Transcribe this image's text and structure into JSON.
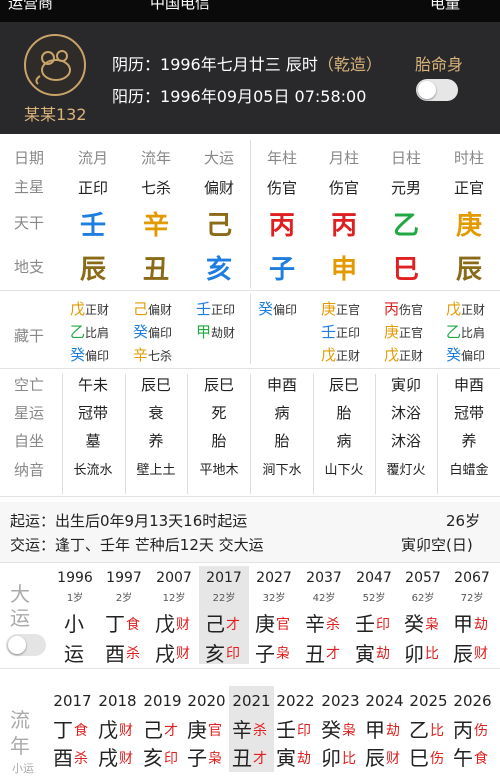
{
  "status": {
    "left1": "运营商",
    "left2": "中国电信",
    "right": "电量"
  },
  "header": {
    "username": "某某132",
    "lunar_label": "阴历：",
    "lunar_date": "1996年七月廿三 辰时",
    "lunar_tag": "（乾造）",
    "solar_label": "阳历：",
    "solar_date": "1996年09月05日 07:58:00",
    "taiming_label": "胎命身"
  },
  "pillars": {
    "row_labels": [
      "日期",
      "主星",
      "天干",
      "地支"
    ],
    "headers": [
      "流月",
      "流年",
      "大运",
      "年柱",
      "月柱",
      "日柱",
      "时柱"
    ],
    "stars": [
      "正印",
      "七杀",
      "偏财",
      "伤官",
      "伤官",
      "元男",
      "正官"
    ],
    "stems": [
      "壬",
      "辛",
      "己",
      "丙",
      "丙",
      "乙",
      "庚"
    ],
    "branches": [
      "辰",
      "丑",
      "亥",
      "子",
      "申",
      "巳",
      "辰"
    ],
    "stem_colors": [
      "#1e7ee0",
      "#e39a00",
      "#8a6a16",
      "#e02020",
      "#e02020",
      "#21a844",
      "#e39a00"
    ],
    "branch_colors": [
      "#8a6a16",
      "#8a6a16",
      "#1e7ee0",
      "#1e7ee0",
      "#e39a00",
      "#e02020",
      "#8a6a16"
    ]
  },
  "canggan": {
    "label": "藏干",
    "cols": [
      [
        {
          "g": "戊",
          "s": "正财",
          "c": "#e39a00"
        },
        {
          "g": "乙",
          "s": "比肩",
          "c": "#21a844"
        },
        {
          "g": "癸",
          "s": "偏印",
          "c": "#1e7ee0"
        }
      ],
      [
        {
          "g": "己",
          "s": "偏财",
          "c": "#e39a00"
        },
        {
          "g": "癸",
          "s": "偏印",
          "c": "#1e7ee0"
        },
        {
          "g": "辛",
          "s": "七杀",
          "c": "#e39a00"
        }
      ],
      [
        {
          "g": "壬",
          "s": "正印",
          "c": "#1e7ee0"
        },
        {
          "g": "甲",
          "s": "劫财",
          "c": "#21a844"
        }
      ],
      [
        {
          "g": "癸",
          "s": "偏印",
          "c": "#1e7ee0"
        }
      ],
      [
        {
          "g": "庚",
          "s": "正官",
          "c": "#e39a00"
        },
        {
          "g": "壬",
          "s": "正印",
          "c": "#1e7ee0"
        },
        {
          "g": "戊",
          "s": "正财",
          "c": "#e39a00"
        }
      ],
      [
        {
          "g": "丙",
          "s": "伤官",
          "c": "#e02020"
        },
        {
          "g": "庚",
          "s": "正官",
          "c": "#e39a00"
        },
        {
          "g": "戊",
          "s": "正财",
          "c": "#e39a00"
        }
      ],
      [
        {
          "g": "戊",
          "s": "正财",
          "c": "#e39a00"
        },
        {
          "g": "乙",
          "s": "比肩",
          "c": "#21a844"
        },
        {
          "g": "癸",
          "s": "偏印",
          "c": "#1e7ee0"
        }
      ]
    ]
  },
  "extra": {
    "row_labels": [
      "空亡",
      "星运",
      "自坐",
      "纳音"
    ],
    "kongwang": [
      "午未",
      "辰巳",
      "辰巳",
      "申酉",
      "辰巳",
      "寅卯",
      "申酉"
    ],
    "xingyun": [
      "冠带",
      "衰",
      "死",
      "病",
      "胎",
      "沐浴",
      "冠带"
    ],
    "zizuo": [
      "墓",
      "养",
      "胎",
      "胎",
      "病",
      "沐浴",
      "养"
    ],
    "nayin": [
      "长流水",
      "壁上土",
      "平地木",
      "涧下水",
      "山下火",
      "覆灯火",
      "白蜡金"
    ]
  },
  "qiyun": {
    "line1": "起运：出生后0年9月13天16时起运",
    "age": "26岁",
    "line2": "交运：逢丁、壬年 芒种后12天 交大运",
    "kong": "寅卯空(日)"
  },
  "dayun": {
    "label1": "大",
    "label2": "运",
    "items": [
      {
        "year": "1996",
        "age": "1岁",
        "g": "小",
        "s1": "",
        "z": "运",
        "s2": "",
        "c1": "#222",
        "c2": "#222"
      },
      {
        "year": "1997",
        "age": "2岁",
        "g": "丁",
        "s1": "食",
        "z": "酉",
        "s2": "杀",
        "c1": "#222",
        "c2": "#e02020"
      },
      {
        "year": "2007",
        "age": "12岁",
        "g": "戊",
        "s1": "财",
        "z": "戌",
        "s2": "财",
        "c1": "#e02020",
        "c2": "#e02020"
      },
      {
        "year": "2017",
        "age": "22岁",
        "g": "己",
        "s1": "才",
        "z": "亥",
        "s2": "印",
        "c1": "#e02020",
        "c2": "#e02020"
      },
      {
        "year": "2027",
        "age": "32岁",
        "g": "庚",
        "s1": "官",
        "z": "子",
        "s2": "枭",
        "c1": "#e02020",
        "c2": "#e02020"
      },
      {
        "year": "2037",
        "age": "42岁",
        "g": "辛",
        "s1": "杀",
        "z": "丑",
        "s2": "才",
        "c1": "#e02020",
        "c2": "#e02020"
      },
      {
        "year": "2047",
        "age": "52岁",
        "g": "壬",
        "s1": "印",
        "z": "寅",
        "s2": "劫",
        "c1": "#e02020",
        "c2": "#e02020"
      },
      {
        "year": "2057",
        "age": "62岁",
        "g": "癸",
        "s1": "枭",
        "z": "卯",
        "s2": "比",
        "c1": "#e02020",
        "c2": "#e02020"
      },
      {
        "year": "2067",
        "age": "72岁",
        "g": "甲",
        "s1": "劫",
        "z": "辰",
        "s2": "财",
        "c1": "#e02020",
        "c2": "#e02020"
      }
    ]
  },
  "liunian": {
    "label1": "流",
    "label2": "年",
    "label3": "小运",
    "items": [
      {
        "year": "2017",
        "g": "丁",
        "s1": "食",
        "z": "酉",
        "s2": "杀"
      },
      {
        "year": "2018",
        "g": "戊",
        "s1": "财",
        "z": "戌",
        "s2": "财"
      },
      {
        "year": "2019",
        "g": "己",
        "s1": "才",
        "z": "亥",
        "s2": "印"
      },
      {
        "year": "2020",
        "g": "庚",
        "s1": "官",
        "z": "子",
        "s2": "枭"
      },
      {
        "year": "2021",
        "g": "辛",
        "s1": "杀",
        "z": "丑",
        "s2": "才"
      },
      {
        "year": "2022",
        "g": "壬",
        "s1": "印",
        "z": "寅",
        "s2": "劫"
      },
      {
        "year": "2023",
        "g": "癸",
        "s1": "枭",
        "z": "卯",
        "s2": "比"
      },
      {
        "year": "2024",
        "g": "甲",
        "s1": "劫",
        "z": "辰",
        "s2": "财"
      },
      {
        "year": "2025",
        "g": "乙",
        "s1": "比",
        "z": "巳",
        "s2": "伤"
      },
      {
        "year": "2026",
        "g": "丙",
        "s1": "伤",
        "z": "午",
        "s2": "食"
      }
    ]
  }
}
